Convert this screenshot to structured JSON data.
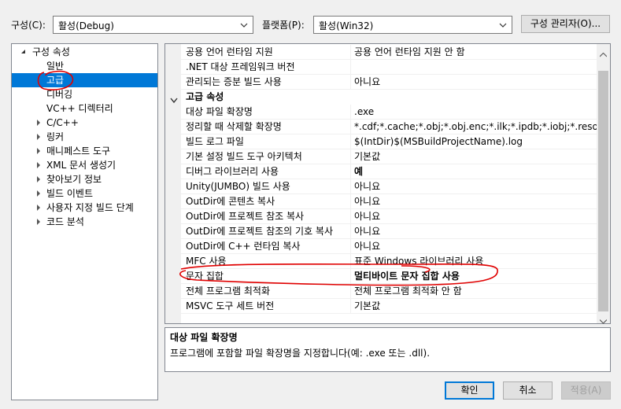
{
  "toolbar": {
    "config_label": "구성(C):",
    "config_value": "활성(Debug)",
    "platform_label": "플랫폼(P):",
    "platform_value": "활성(Win32)",
    "config_manager_button": "구성 관리자(O)..."
  },
  "tree": {
    "root": "구성 속성",
    "items": [
      {
        "label": "일반",
        "expandable": false
      },
      {
        "label": "고급",
        "expandable": false,
        "selected": true
      },
      {
        "label": "디버깅",
        "expandable": false
      },
      {
        "label": "VC++ 디렉터리",
        "expandable": false
      },
      {
        "label": "C/C++",
        "expandable": true
      },
      {
        "label": "링커",
        "expandable": true
      },
      {
        "label": "매니페스트 도구",
        "expandable": true
      },
      {
        "label": "XML 문서 생성기",
        "expandable": true
      },
      {
        "label": "찾아보기 정보",
        "expandable": true
      },
      {
        "label": "빌드 이벤트",
        "expandable": true
      },
      {
        "label": "사용자 지정 빌드 단계",
        "expandable": true
      },
      {
        "label": "코드 분석",
        "expandable": true
      }
    ]
  },
  "grid": {
    "rows": [
      {
        "name": "공용 언어 런타임 지원",
        "value": "공용 언어 런타임 지원 안 함"
      },
      {
        "name": ".NET 대상 프레임워크 버전",
        "value": ""
      },
      {
        "name": "관리되는 증분 빌드 사용",
        "value": "아니요"
      },
      {
        "category": true,
        "name": "고급 속성"
      },
      {
        "name": "대상 파일 확장명",
        "value": ".exe"
      },
      {
        "name": "정리할 때 삭제할 확장명",
        "value": "*.cdf;*.cache;*.obj;*.obj.enc;*.ilk;*.ipdb;*.iobj;*.resources;*.tlb;"
      },
      {
        "name": "빌드 로그 파일",
        "value": "$(IntDir)$(MSBuildProjectName).log"
      },
      {
        "name": "기본 설정 빌드 도구 아키텍처",
        "value": "기본값"
      },
      {
        "name": "디버그 라이브러리 사용",
        "value": "예",
        "bold": true
      },
      {
        "name": "Unity(JUMBO) 빌드 사용",
        "value": "아니요"
      },
      {
        "name": "OutDir에 콘텐츠 복사",
        "value": "아니요"
      },
      {
        "name": "OutDir에 프로젝트 참조 복사",
        "value": "아니요"
      },
      {
        "name": "OutDir에 프로젝트 참조의 기호 복사",
        "value": "아니요"
      },
      {
        "name": "OutDir에 C++ 런타임 복사",
        "value": "아니요"
      },
      {
        "name": "MFC 사용",
        "value": "표준 Windows 라이브러리 사용"
      },
      {
        "name": "문자 집합",
        "value": "멀티바이트 문자 집합 사용",
        "bold": true
      },
      {
        "name": "전체 프로그램 최적화",
        "value": "전체 프로그램 최적화 안 함"
      },
      {
        "name": "MSVC 도구 세트 버전",
        "value": "기본값"
      }
    ]
  },
  "description": {
    "title": "대상 파일 확장명",
    "text": "프로그램에 포함할 파일 확장명을 지정합니다(예: .exe 또는 .dll)."
  },
  "buttons": {
    "ok": "확인",
    "cancel": "취소",
    "apply": "적용(A)"
  },
  "annotation_color": "#e00000"
}
